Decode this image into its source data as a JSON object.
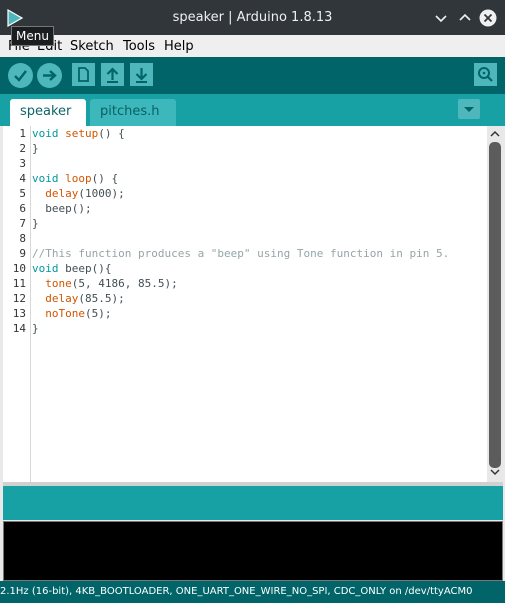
{
  "window": {
    "title": "speaker | Arduino 1.8.13",
    "icon": "arduino-app-icon",
    "controls": [
      "minimize-icon",
      "maximize-icon",
      "close-icon"
    ]
  },
  "tooltip": "Menu",
  "menubar": {
    "items": [
      "File",
      "Edit",
      "Sketch",
      "Tools",
      "Help"
    ]
  },
  "toolbar": {
    "buttons": [
      "verify-icon",
      "upload-icon",
      "new-icon",
      "open-icon",
      "save-icon"
    ],
    "right_button": "serial-monitor-icon"
  },
  "tabs": [
    {
      "label": "speaker",
      "active": true
    },
    {
      "label": "pitches.h",
      "active": false
    }
  ],
  "editor": {
    "line_numbers": [
      "1",
      "2",
      "3",
      "4",
      "5",
      "6",
      "7",
      "8",
      "9",
      "10",
      "11",
      "12",
      "13",
      "14"
    ],
    "lines": [
      [
        {
          "t": "void",
          "c": "type"
        },
        {
          "t": " "
        },
        {
          "t": "setup",
          "c": "fn"
        },
        {
          "t": "() {"
        }
      ],
      [
        {
          "t": "}"
        }
      ],
      [
        {
          "t": ""
        }
      ],
      [
        {
          "t": "void",
          "c": "type"
        },
        {
          "t": " "
        },
        {
          "t": "loop",
          "c": "fn"
        },
        {
          "t": "() {"
        }
      ],
      [
        {
          "t": "  "
        },
        {
          "t": "delay",
          "c": "fn"
        },
        {
          "t": "(1000);"
        }
      ],
      [
        {
          "t": "  beep();"
        }
      ],
      [
        {
          "t": "}"
        }
      ],
      [
        {
          "t": ""
        }
      ],
      [
        {
          "t": "//This function produces a \"beep\" using Tone function in pin 5.",
          "c": "comment"
        }
      ],
      [
        {
          "t": "void",
          "c": "type"
        },
        {
          "t": " beep(){"
        }
      ],
      [
        {
          "t": "  "
        },
        {
          "t": "tone",
          "c": "fn"
        },
        {
          "t": "(5, 4186, 85.5);"
        }
      ],
      [
        {
          "t": "  "
        },
        {
          "t": "delay",
          "c": "fn"
        },
        {
          "t": "(85.5);"
        }
      ],
      [
        {
          "t": "  "
        },
        {
          "t": "noTone",
          "c": "fn"
        },
        {
          "t": "(5);"
        }
      ],
      [
        {
          "t": "}"
        }
      ]
    ]
  },
  "status_bar": {
    "text": "2.1Hz (16-bit), 4KB_BOOTLOADER, ONE_UART_ONE_WIRE_NO_SPI, CDC_ONLY on /dev/ttyACM0"
  },
  "colors": {
    "titlebar": "#31363b",
    "toolbar": "#006468",
    "tabbar": "#17a1a5",
    "button": "#4db7bb",
    "keyword_type": "#00979d",
    "keyword_fn": "#d35400",
    "comment": "#95a5a6"
  }
}
